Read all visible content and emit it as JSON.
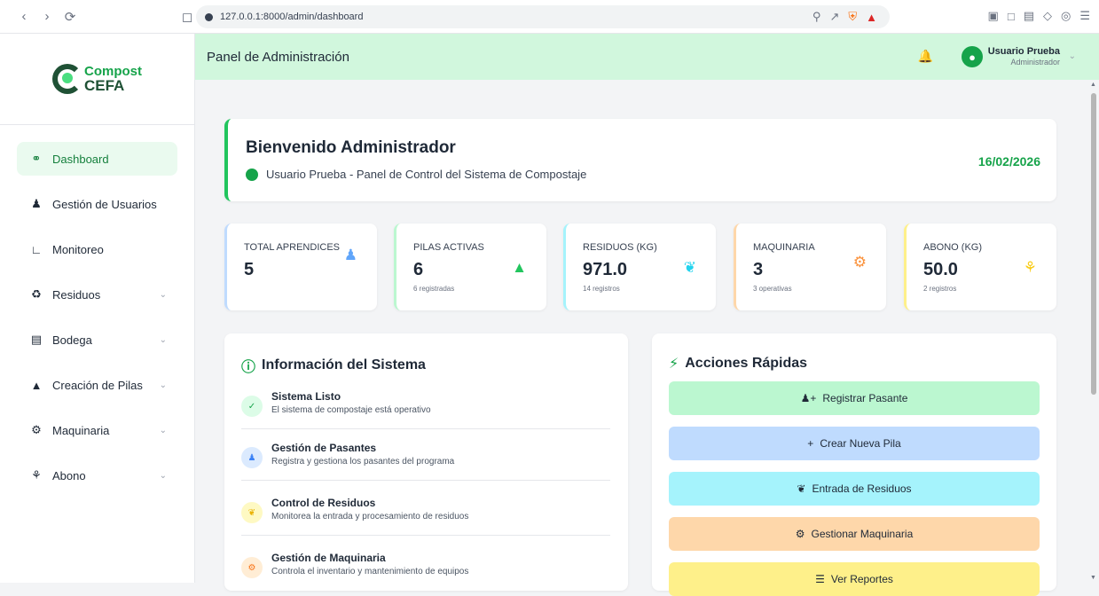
{
  "browser": {
    "url": "127.0.0.1:8000/admin/dashboard"
  },
  "logo": {
    "line1": "Compost",
    "line2": "CEFA"
  },
  "sidebar": {
    "items": [
      {
        "label": "Dashboard",
        "icon": "globe-icon"
      },
      {
        "label": "Gestión de Usuarios",
        "icon": "users-icon"
      },
      {
        "label": "Monitoreo",
        "icon": "chart-line-icon"
      },
      {
        "label": "Residuos",
        "icon": "recycle-icon"
      },
      {
        "label": "Bodega",
        "icon": "warehouse-icon"
      },
      {
        "label": "Creación de Pilas",
        "icon": "mountain-icon"
      },
      {
        "label": "Maquinaria",
        "icon": "gears-icon"
      },
      {
        "label": "Abono",
        "icon": "seedling-icon"
      }
    ]
  },
  "header": {
    "title": "Panel de Administración",
    "user_name": "Usuario Prueba",
    "user_role": "Administrador"
  },
  "welcome": {
    "title": "Bienvenido Administrador",
    "subtitle": "Usuario Prueba - Panel de Control del Sistema de Compostaje",
    "date": "16/02/2026"
  },
  "stats": [
    {
      "label": "TOTAL APRENDICES",
      "value": "5",
      "note": "",
      "color": "#60a5fa"
    },
    {
      "label": "PILAS ACTIVAS",
      "value": "6",
      "note": "6 registradas",
      "color": "#22c55e"
    },
    {
      "label": "RESIDUOS (KG)",
      "value": "971.0",
      "note": "14 registros",
      "color": "#22d3ee"
    },
    {
      "label": "MAQUINARIA",
      "value": "3",
      "note": "3 operativas",
      "color": "#fb923c"
    },
    {
      "label": "ABONO (KG)",
      "value": "50.0",
      "note": "2 registros",
      "color": "#facc15"
    }
  ],
  "info_panel": {
    "title": "Información del Sistema",
    "items": [
      {
        "title": "Sistema Listo",
        "desc": "El sistema de compostaje está operativo"
      },
      {
        "title": "Gestión de Pasantes",
        "desc": "Registra y gestiona los pasantes del programa"
      },
      {
        "title": "Control de Residuos",
        "desc": "Monitorea la entrada y procesamiento de residuos"
      },
      {
        "title": "Gestión de Maquinaria",
        "desc": "Controla el inventario y mantenimiento de equipos"
      }
    ]
  },
  "actions_panel": {
    "title": "Acciones Rápidas",
    "buttons": [
      {
        "label": "Registrar Pasante",
        "color": "#bbf7d0"
      },
      {
        "label": "Crear Nueva Pila",
        "color": "#bfdbfe"
      },
      {
        "label": "Entrada de Residuos",
        "color": "#a5f3fc"
      },
      {
        "label": "Gestionar Maquinaria",
        "color": "#fed7aa"
      },
      {
        "label": "Ver Reportes",
        "color": "#fef08a"
      }
    ]
  }
}
